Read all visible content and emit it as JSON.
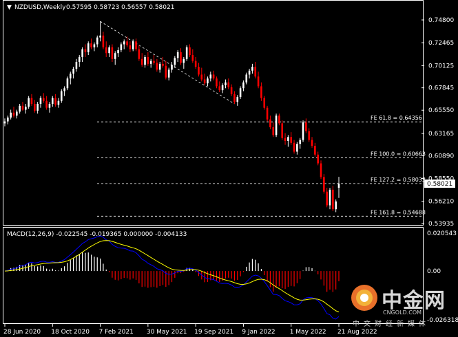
{
  "header": {
    "symbol": "NZDUSD,Weekly",
    "ohlc": "0.57595 0.58723 0.56557 0.58021"
  },
  "macd": {
    "label": "MACD(12,26,9) -0.022545 -0.019365 0.000000 -0.004133",
    "ticks": [
      "0.020543",
      "0.00",
      "-0.026318"
    ]
  },
  "watermark": {
    "brand": "中金网",
    "site": "CNGOLD.COM",
    "tagline": "中文财经新媒体"
  },
  "colors": {
    "bull": "#ffffff",
    "bear": "#ff0000",
    "macd_line": "#0000ff",
    "signal_line": "#ffff00"
  },
  "chart_data": [
    {
      "type": "candlestick",
      "title": "NZDUSD,Weekly",
      "yticks": [
        "0.74800",
        "0.72465",
        "0.70125",
        "0.67845",
        "0.65550",
        "0.63165",
        "0.60890",
        "0.58550",
        "0.56210",
        "0.53935"
      ],
      "ylim": [
        0.53935,
        0.748
      ],
      "xticks": [
        "28 Jun 2020",
        "18 Oct 2020",
        "7 Feb 2021",
        "30 May 2021",
        "19 Sep 2021",
        "9 Jan 2022",
        "1 May 2022",
        "21 Aug 2022"
      ],
      "last_price": "0.58021",
      "fib_levels": [
        {
          "label": "FE 61.8 = 0.64356",
          "value": 0.64356
        },
        {
          "label": "FE 100.0 = 0.60663",
          "value": 0.60663
        },
        {
          "label": "FE 127.2 = 0.58033",
          "value": 0.58033
        },
        {
          "label": "FE 161.8 = 0.54688",
          "value": 0.54688
        }
      ],
      "series": [
        {
          "ohlc": [
            [
              0.642,
              0.647,
              0.639,
              0.644
            ],
            [
              0.644,
              0.65,
              0.641,
              0.648
            ],
            [
              0.648,
              0.656,
              0.646,
              0.653
            ],
            [
              0.653,
              0.659,
              0.648,
              0.65
            ],
            [
              0.65,
              0.656,
              0.647,
              0.654
            ],
            [
              0.654,
              0.662,
              0.652,
              0.66
            ],
            [
              0.66,
              0.664,
              0.655,
              0.656
            ],
            [
              0.656,
              0.662,
              0.652,
              0.659
            ],
            [
              0.659,
              0.67,
              0.657,
              0.668
            ],
            [
              0.668,
              0.672,
              0.66,
              0.662
            ],
            [
              0.662,
              0.666,
              0.653,
              0.655
            ],
            [
              0.655,
              0.664,
              0.652,
              0.662
            ],
            [
              0.662,
              0.67,
              0.658,
              0.668
            ],
            [
              0.668,
              0.673,
              0.663,
              0.665
            ],
            [
              0.665,
              0.67,
              0.656,
              0.658
            ],
            [
              0.658,
              0.664,
              0.653,
              0.662
            ],
            [
              0.662,
              0.67,
              0.659,
              0.668
            ],
            [
              0.668,
              0.672,
              0.659,
              0.661
            ],
            [
              0.661,
              0.668,
              0.658,
              0.665
            ],
            [
              0.665,
              0.677,
              0.663,
              0.675
            ],
            [
              0.675,
              0.68,
              0.67,
              0.678
            ],
            [
              0.678,
              0.69,
              0.676,
              0.688
            ],
            [
              0.688,
              0.695,
              0.682,
              0.693
            ],
            [
              0.693,
              0.7,
              0.688,
              0.698
            ],
            [
              0.698,
              0.708,
              0.695,
              0.705
            ],
            [
              0.705,
              0.712,
              0.7,
              0.71
            ],
            [
              0.71,
              0.72,
              0.705,
              0.718
            ],
            [
              0.718,
              0.723,
              0.71,
              0.715
            ],
            [
              0.715,
              0.726,
              0.712,
              0.724
            ],
            [
              0.724,
              0.729,
              0.718,
              0.72
            ],
            [
              0.72,
              0.725,
              0.716,
              0.723
            ],
            [
              0.723,
              0.732,
              0.72,
              0.73
            ],
            [
              0.73,
              0.7465,
              0.726,
              0.732
            ],
            [
              0.732,
              0.736,
              0.718,
              0.72
            ],
            [
              0.72,
              0.726,
              0.71,
              0.714
            ],
            [
              0.714,
              0.722,
              0.71,
              0.72
            ],
            [
              0.72,
              0.723,
              0.705,
              0.708
            ],
            [
              0.708,
              0.716,
              0.702,
              0.714
            ],
            [
              0.714,
              0.72,
              0.71,
              0.717
            ],
            [
              0.717,
              0.725,
              0.715,
              0.723
            ],
            [
              0.723,
              0.728,
              0.718,
              0.726
            ],
            [
              0.726,
              0.731,
              0.72,
              0.722
            ],
            [
              0.722,
              0.726,
              0.715,
              0.718
            ],
            [
              0.718,
              0.728,
              0.716,
              0.726
            ],
            [
              0.726,
              0.729,
              0.716,
              0.718
            ],
            [
              0.718,
              0.722,
              0.706,
              0.708
            ],
            [
              0.708,
              0.714,
              0.7,
              0.702
            ],
            [
              0.702,
              0.712,
              0.699,
              0.71
            ],
            [
              0.71,
              0.715,
              0.701,
              0.703
            ],
            [
              0.703,
              0.708,
              0.699,
              0.706
            ],
            [
              0.706,
              0.712,
              0.702,
              0.704
            ],
            [
              0.704,
              0.708,
              0.695,
              0.697
            ],
            [
              0.697,
              0.705,
              0.694,
              0.703
            ],
            [
              0.703,
              0.71,
              0.699,
              0.701
            ],
            [
              0.701,
              0.706,
              0.687,
              0.689
            ],
            [
              0.689,
              0.699,
              0.686,
              0.697
            ],
            [
              0.697,
              0.705,
              0.694,
              0.702
            ],
            [
              0.702,
              0.711,
              0.699,
              0.709
            ],
            [
              0.709,
              0.717,
              0.705,
              0.715
            ],
            [
              0.715,
              0.719,
              0.702,
              0.704
            ],
            [
              0.704,
              0.71,
              0.698,
              0.708
            ],
            [
              0.708,
              0.722,
              0.706,
              0.72
            ],
            [
              0.72,
              0.723,
              0.71,
              0.712
            ],
            [
              0.712,
              0.718,
              0.704,
              0.706
            ],
            [
              0.706,
              0.71,
              0.698,
              0.7
            ],
            [
              0.7,
              0.704,
              0.69,
              0.692
            ],
            [
              0.692,
              0.699,
              0.685,
              0.687
            ],
            [
              0.687,
              0.693,
              0.681,
              0.683
            ],
            [
              0.683,
              0.69,
              0.68,
              0.688
            ],
            [
              0.688,
              0.695,
              0.685,
              0.692
            ],
            [
              0.692,
              0.696,
              0.686,
              0.688
            ],
            [
              0.688,
              0.69,
              0.678,
              0.68
            ],
            [
              0.68,
              0.685,
              0.674,
              0.676
            ],
            [
              0.676,
              0.683,
              0.673,
              0.681
            ],
            [
              0.681,
              0.687,
              0.678,
              0.684
            ],
            [
              0.684,
              0.688,
              0.677,
              0.679
            ],
            [
              0.679,
              0.682,
              0.67,
              0.672
            ],
            [
              0.672,
              0.675,
              0.662,
              0.664
            ],
            [
              0.664,
              0.671,
              0.66,
              0.669
            ],
            [
              0.669,
              0.68,
              0.667,
              0.678
            ],
            [
              0.678,
              0.686,
              0.675,
              0.684
            ],
            [
              0.684,
              0.694,
              0.682,
              0.692
            ],
            [
              0.692,
              0.698,
              0.688,
              0.696
            ],
            [
              0.696,
              0.703,
              0.693,
              0.7
            ],
            [
              0.7,
              0.705,
              0.688,
              0.69
            ],
            [
              0.69,
              0.695,
              0.678,
              0.68
            ],
            [
              0.68,
              0.684,
              0.665,
              0.668
            ],
            [
              0.668,
              0.67,
              0.656,
              0.658
            ],
            [
              0.658,
              0.66,
              0.644,
              0.646
            ],
            [
              0.646,
              0.65,
              0.636,
              0.638
            ],
            [
              0.638,
              0.643,
              0.628,
              0.63
            ],
            [
              0.63,
              0.652,
              0.628,
              0.65
            ],
            [
              0.65,
              0.652,
              0.64,
              0.642
            ],
            [
              0.642,
              0.645,
              0.625,
              0.627
            ],
            [
              0.627,
              0.632,
              0.62,
              0.624
            ],
            [
              0.624,
              0.63,
              0.618,
              0.628
            ],
            [
              0.628,
              0.633,
              0.62,
              0.622
            ],
            [
              0.622,
              0.625,
              0.611,
              0.613
            ],
            [
              0.613,
              0.623,
              0.61,
              0.621
            ],
            [
              0.621,
              0.627,
              0.616,
              0.625
            ],
            [
              0.625,
              0.645,
              0.623,
              0.643
            ],
            [
              0.643,
              0.647,
              0.632,
              0.634
            ],
            [
              0.634,
              0.637,
              0.623,
              0.625
            ],
            [
              0.625,
              0.628,
              0.617,
              0.619
            ],
            [
              0.619,
              0.622,
              0.608,
              0.61
            ],
            [
              0.61,
              0.613,
              0.599,
              0.601
            ],
            [
              0.601,
              0.604,
              0.585,
              0.587
            ],
            [
              0.587,
              0.59,
              0.57,
              0.572
            ],
            [
              0.572,
              0.576,
              0.556,
              0.558
            ],
            [
              0.558,
              0.576,
              0.554,
              0.574
            ],
            [
              0.574,
              0.578,
              0.552,
              0.554
            ],
            [
              0.554,
              0.564,
              0.551,
              0.562
            ],
            [
              0.576,
              0.5872,
              0.5656,
              0.5802
            ]
          ]
        }
      ]
    },
    {
      "type": "macd",
      "title": "MACD(12,26,9)",
      "params": [
        12,
        26,
        9
      ],
      "ylim": [
        -0.026318,
        0.020543
      ],
      "values": {
        "macd": -0.022545,
        "signal": -0.019365,
        "zero": 0.0,
        "histogram": -0.004133
      }
    }
  ]
}
